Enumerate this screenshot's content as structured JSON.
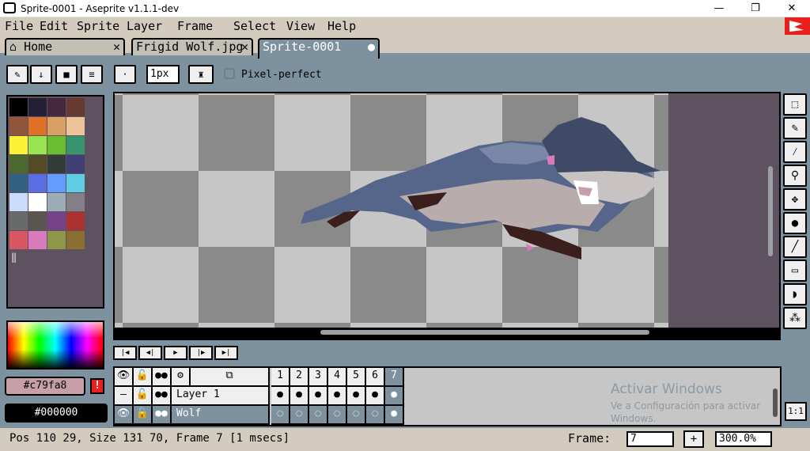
{
  "window": {
    "title": "Sprite-0001 - Aseprite v1.1.1-dev",
    "minimize_label": "—",
    "maximize_label": "❐",
    "close_label": "✕"
  },
  "menu": {
    "items": [
      "File",
      "Edit",
      "Sprite",
      "Layer",
      "Frame",
      "Select",
      "View",
      "Help"
    ]
  },
  "tabs": [
    {
      "label": "Home",
      "icon": "home-icon",
      "close": "✕"
    },
    {
      "label": "Frigid Wolf.jpg",
      "close": "✕"
    },
    {
      "label": "Sprite-0001",
      "close": "●"
    }
  ],
  "toolbar": {
    "brush_size": "1px",
    "pixel_perfect_label": "Pixel-perfect",
    "pixel_perfect_checked": false
  },
  "palette": {
    "colors": [
      "#000000",
      "#222034",
      "#45283c",
      "#663931",
      "#8f563b",
      "#df7126",
      "#d9a066",
      "#eec39a",
      "#fbf236",
      "#99e550",
      "#6abe30",
      "#37946e",
      "#4b692f",
      "#524b24",
      "#323c39",
      "#3f3f74",
      "#306082",
      "#5b6ee1",
      "#639bff",
      "#5fcde4",
      "#cbdbfc",
      "#ffffff",
      "#9badb7",
      "#847e87",
      "#696a6a",
      "#595652",
      "#76428a",
      "#ac3232",
      "#d95763",
      "#d77bba",
      "#8f974a",
      "#8a6f30"
    ]
  },
  "colors": {
    "fg_hex": "#c79fa8",
    "bg_hex": "#000000",
    "warning_label": "!"
  },
  "timeline": {
    "frames": [
      "1",
      "2",
      "3",
      "4",
      "5",
      "6",
      "7"
    ],
    "current_frame": "7",
    "layers": [
      {
        "name": "Layer 1"
      },
      {
        "name": "Wolf"
      }
    ]
  },
  "watermark": {
    "line1": "Activar Windows",
    "line2": "Ve a Configuración para activar",
    "line3": "Windows."
  },
  "status": {
    "text": "Pos 110 29, Size 131 70, Frame 7 [1 msecs]",
    "frame_label": "Frame:",
    "frame_value": "7",
    "add_label": "+",
    "zoom": "300.0%"
  },
  "zoom_button_label": "1:1"
}
